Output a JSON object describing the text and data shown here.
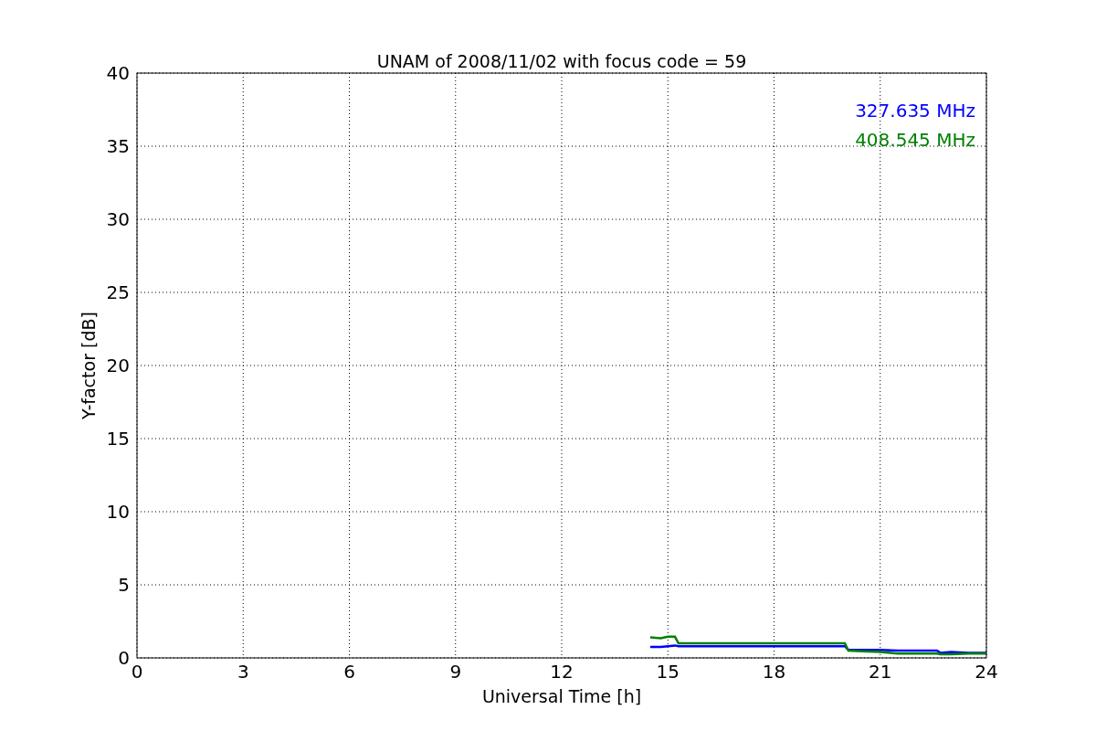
{
  "chart_data": {
    "type": "line",
    "title": "UNAM of 2008/11/02 with focus code = 59",
    "xlabel": "Universal Time [h]",
    "ylabel": "Y-factor [dB]",
    "x": [
      14.5,
      14.8,
      15.0,
      15.2,
      15.3,
      20.0,
      20.1,
      20.5,
      21.0,
      21.5,
      22.0,
      22.6,
      22.7,
      23.0,
      23.5,
      24.0
    ],
    "series": [
      {
        "name": "327.635 MHz",
        "color": "#0000ff",
        "values": [
          0.75,
          0.75,
          0.8,
          0.85,
          0.8,
          0.8,
          0.55,
          0.55,
          0.55,
          0.5,
          0.5,
          0.5,
          0.35,
          0.4,
          0.35,
          0.35
        ]
      },
      {
        "name": "408.545 MHz",
        "color": "#008000",
        "values": [
          1.4,
          1.35,
          1.45,
          1.45,
          1.0,
          1.0,
          0.5,
          0.45,
          0.4,
          0.3,
          0.3,
          0.3,
          0.25,
          0.25,
          0.3,
          0.3
        ]
      }
    ],
    "grid": true,
    "xlim": [
      0,
      24
    ],
    "ylim": [
      0,
      40
    ],
    "xticks": [
      0,
      3,
      6,
      9,
      12,
      15,
      18,
      21,
      24
    ],
    "yticks": [
      0,
      5,
      10,
      15,
      20,
      25,
      30,
      35,
      40
    ]
  }
}
